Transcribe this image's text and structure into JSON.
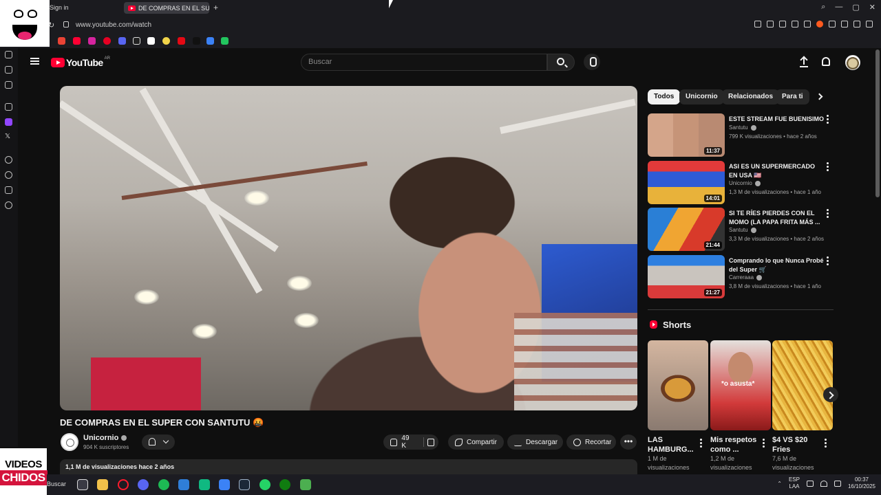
{
  "browser": {
    "sign_in": "Sign in",
    "tab_title": "DE COMPRAS EN EL SUPER CON SANTUTU",
    "new_tab": "+",
    "url": "www.youtube.com/watch",
    "window_controls": [
      "⌕",
      "—",
      "▢",
      "✕"
    ]
  },
  "youtube": {
    "logo_text": "YouTube",
    "country_code": "AR",
    "search_placeholder": "Buscar"
  },
  "video": {
    "title": "DE COMPRAS EN EL SUPER CON SANTUTU 🤬",
    "channel": "Unicornio",
    "subscribers": "904 K suscriptores",
    "likes": "49 K",
    "share_label": "Compartir",
    "download_label": "Descargar",
    "clip_label": "Recortar",
    "more_label": "•••",
    "description_meta": "1,1 M de visualizaciones  hace 2 años"
  },
  "chips": [
    "Todos",
    "Unicornio",
    "Relacionados",
    "Para ti"
  ],
  "related": [
    {
      "title": "ESTE STREAM FUE BUENISIMO",
      "channel": "Santutu",
      "meta": "799 K visualizaciones • hace 2 años",
      "duration": "11:37"
    },
    {
      "title": "ASI ES UN SUPERMERCADO EN USA 🇺🇸",
      "channel": "Unicornio",
      "meta": "1,3 M de visualizaciones • hace 1 año",
      "duration": "14:01"
    },
    {
      "title": "SI TE RÍES PIERDES CON EL MOMO (LA PAPA FRITA MÁS ...",
      "channel": "Santutu",
      "meta": "3,3 M de visualizaciones • hace 2 años",
      "duration": "21:44"
    },
    {
      "title": "Comprando lo que Nunca Probé del Super 🛒",
      "channel": "Carreraaa",
      "meta": "3,8 M de visualizaciones • hace 1 año",
      "duration": "21:27"
    }
  ],
  "shorts": {
    "heading": "Shorts",
    "items": [
      {
        "title": "LAS HAMBURG...",
        "views": "1 M de visualizaciones",
        "overlay": ""
      },
      {
        "title": "Mis respetos como ...",
        "views": "1,2 M de visualizaciones",
        "overlay": "*o asusta*"
      },
      {
        "title": "$4 VS $20 Fries",
        "views": "7,6 M de visualizaciones",
        "overlay": ""
      }
    ]
  },
  "taskbar": {
    "search_label": "Buscar",
    "lang_top": "ESP",
    "lang_bottom": "LAA",
    "time": "00:37",
    "date": "16/10/2025"
  },
  "watermark": {
    "line1": "VIDEOS",
    "line2": "CHIDOS"
  },
  "colors": {
    "youtube_red": "#ff0033",
    "background": "#0f0f0f",
    "chip_bg": "#272727"
  }
}
